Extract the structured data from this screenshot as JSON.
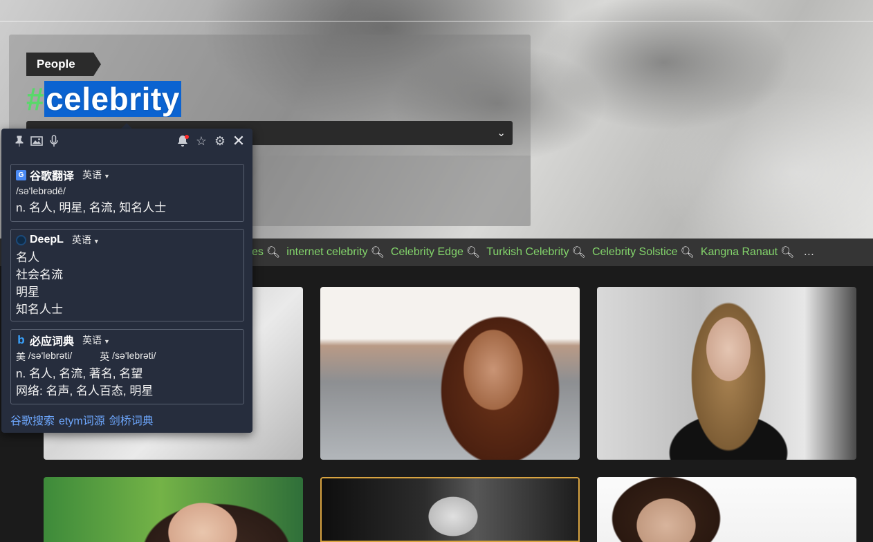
{
  "hero": {
    "category": "People",
    "hash_symbol": "#",
    "hash_word": "celebrity"
  },
  "tags": {
    "partial_first": "es",
    "items": [
      "internet celebrity",
      "Celebrity Edge",
      "Turkish Celebrity",
      "Celebrity Solstice",
      "Kangna Ranaut"
    ],
    "more": "…"
  },
  "popup": {
    "toolbar_icons": [
      "pin-icon",
      "image-icon",
      "mic-icon",
      "bell-icon",
      "star-icon",
      "gear-icon",
      "close-icon"
    ],
    "google": {
      "name": "谷歌翻译",
      "lang": "英语",
      "phonetic": "/sə'lebrədē/",
      "meaning": "n. 名人, 明星, 名流, 知名人士"
    },
    "deepl": {
      "name": "DeepL",
      "lang": "英语",
      "results": [
        "名人",
        "社会名流",
        "明星",
        "知名人士"
      ]
    },
    "bing": {
      "name": "必应词典",
      "lang": "英语",
      "us_label": "美",
      "us_phonetic": "/sə'lebrəti/",
      "uk_label": "英",
      "uk_phonetic": "/sə'lebrəti/",
      "meaning_1": "n. 名人, 名流, 著名, 名望",
      "meaning_2": "网络:  名声, 名人百态, 明星"
    },
    "links": [
      "谷歌搜索",
      "etym词源",
      "剑桥词典"
    ]
  },
  "colors": {
    "tag_green": "#83d46b",
    "hash_green": "#58d86a",
    "highlight_blue": "#0b63d1",
    "popup_bg": "#262d3d",
    "link_blue": "#6ea8ff",
    "selected_card_border": "#d9a441"
  }
}
